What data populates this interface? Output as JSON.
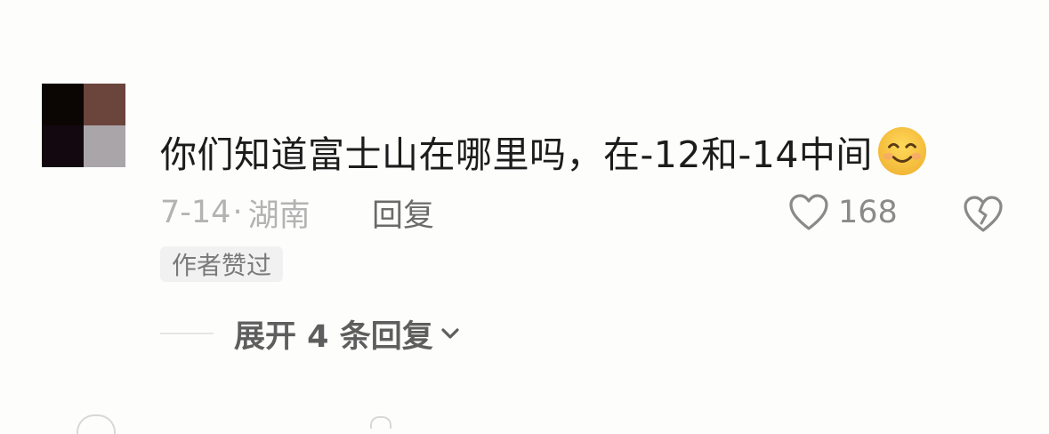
{
  "comment": {
    "text": "你们知道富士山在哪里吗，在-12和-14中间",
    "emoji": "smiling-face-emoji",
    "date": "7-14",
    "separator": "·",
    "location": "湖南",
    "reply_label": "回复",
    "like_count": "168",
    "author_badge": "作者赞过",
    "expand_label": "展开 4 条回复"
  },
  "colors": {
    "text_primary": "#1c1c1c",
    "text_meta": "#b3b3b3",
    "icon_gray": "#8a8a8a",
    "background": "#fdfdfc",
    "emoji_yellow": "#f7c744"
  }
}
